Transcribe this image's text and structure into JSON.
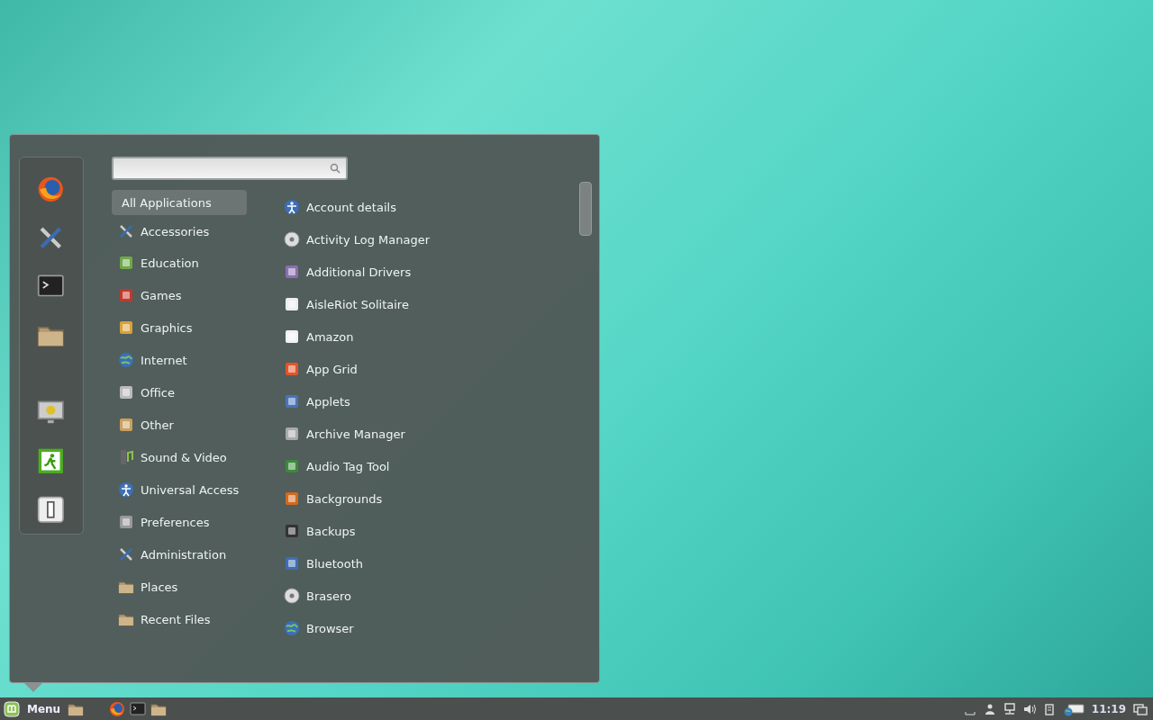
{
  "menu": {
    "categories": [
      {
        "label": "All Applications",
        "selected": true
      },
      {
        "label": "Accessories",
        "selected": false
      },
      {
        "label": "Education",
        "selected": false
      },
      {
        "label": "Games",
        "selected": false
      },
      {
        "label": "Graphics",
        "selected": false
      },
      {
        "label": "Internet",
        "selected": false
      },
      {
        "label": "Office",
        "selected": false
      },
      {
        "label": "Other",
        "selected": false
      },
      {
        "label": "Sound & Video",
        "selected": false
      },
      {
        "label": "Universal Access",
        "selected": false
      },
      {
        "label": "Preferences",
        "selected": false
      },
      {
        "label": "Administration",
        "selected": false
      },
      {
        "label": "Places",
        "selected": false
      },
      {
        "label": "Recent Files",
        "selected": false
      }
    ],
    "applications": [
      "Account details",
      "Activity Log Manager",
      "Additional Drivers",
      "AisleRiot Solitaire",
      "Amazon",
      "App Grid",
      "Applets",
      "Archive Manager",
      "Audio Tag Tool",
      "Backgrounds",
      "Backups",
      "Bluetooth",
      "Brasero",
      "Browser"
    ]
  },
  "taskbar": {
    "menu_button": "Menu",
    "clock": "11:19"
  }
}
